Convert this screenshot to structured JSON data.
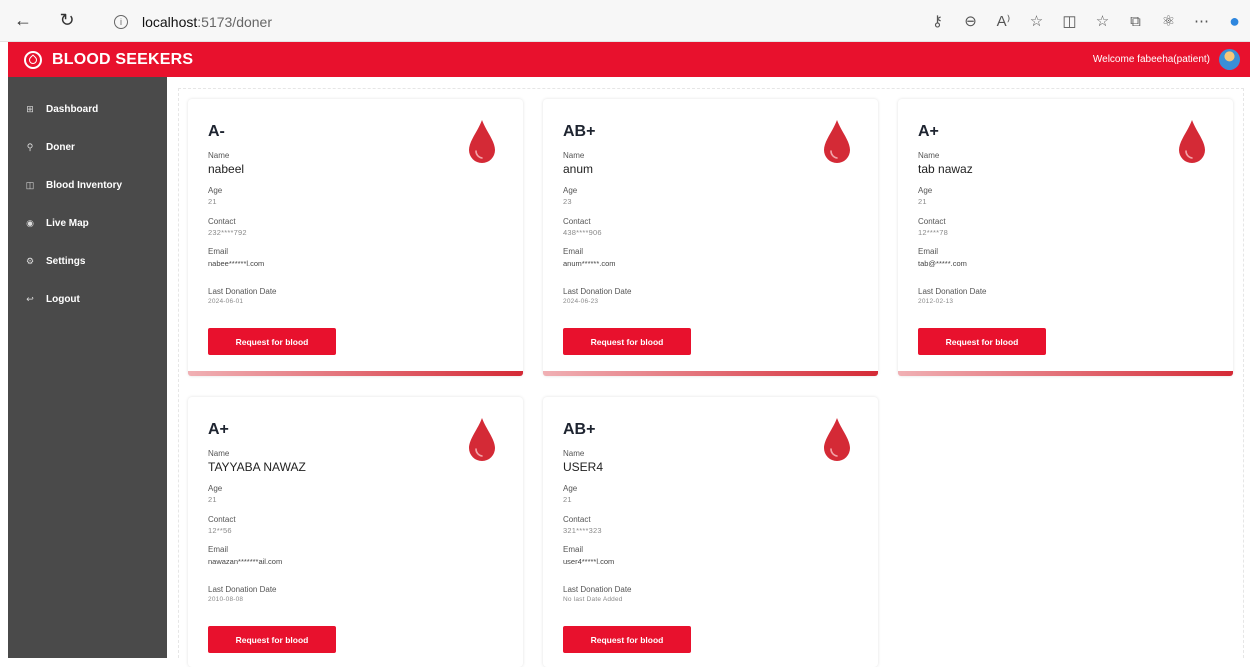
{
  "browser": {
    "url_host": "localhost",
    "url_rest": ":5173/doner"
  },
  "header": {
    "brand": "BLOOD SEEKERS",
    "welcome": "Welcome fabeeha(patient)"
  },
  "sidebar": {
    "items": [
      {
        "label": "Dashboard",
        "icon": "grid-icon"
      },
      {
        "label": "Doner",
        "icon": "user-icon"
      },
      {
        "label": "Blood Inventory",
        "icon": "inventory-icon"
      },
      {
        "label": "Live Map",
        "icon": "map-pin-icon"
      },
      {
        "label": "Settings",
        "icon": "gear-icon"
      },
      {
        "label": "Logout",
        "icon": "logout-icon"
      }
    ]
  },
  "labels": {
    "name": "Name",
    "age": "Age",
    "contact": "Contact",
    "email": "Email",
    "last_donation": "Last Donation Date",
    "request_button": "Request for blood"
  },
  "donors": [
    {
      "blood_type": "A-",
      "name": "nabeel",
      "age": "21",
      "contact": "232****792",
      "email": "nabee******l.com",
      "last_donation": "2024-06-01"
    },
    {
      "blood_type": "AB+",
      "name": "anum",
      "age": "23",
      "contact": "438****906",
      "email": "anum******.com",
      "last_donation": "2024-06-23"
    },
    {
      "blood_type": "A+",
      "name": "tab nawaz",
      "age": "21",
      "contact": "12****78",
      "email": "tab@*****.com",
      "last_donation": "2012-02-13"
    },
    {
      "blood_type": "A+",
      "name": "TAYYABA NAWAZ",
      "age": "21",
      "contact": "12**56",
      "email": "nawazan*******ail.com",
      "last_donation": "2010-08-08"
    },
    {
      "blood_type": "AB+",
      "name": "USER4",
      "age": "21",
      "contact": "321****323",
      "email": "user4*****l.com",
      "last_donation": "No last Date Added"
    }
  ],
  "colors": {
    "brand_red": "#e8112d",
    "sidebar_bg": "#4a4a4a",
    "drop_red": "#d42a36"
  }
}
